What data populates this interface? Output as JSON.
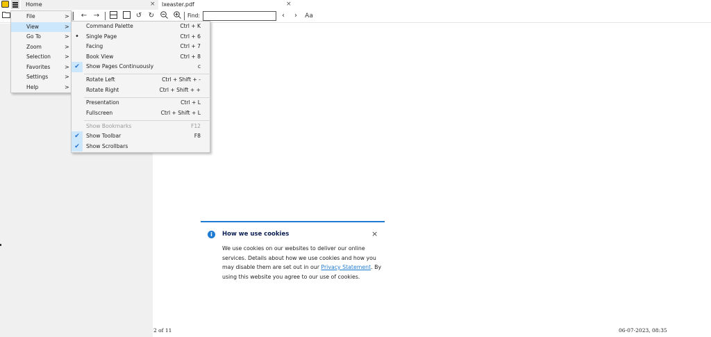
{
  "tabs": [
    {
      "label": "Home",
      "close_glyph": "×"
    },
    {
      "label": "lxeaster.pdf",
      "close_glyph": "×"
    }
  ],
  "toolbar": {
    "find_label": "Find:",
    "find_value": "",
    "icons": [
      "folder-icon",
      "arrow-left-icon",
      "arrow-right-icon",
      "fit-width-icon",
      "fit-page-icon",
      "rotate-left-icon",
      "rotate-right-icon",
      "zoom-out-icon",
      "zoom-in-icon",
      "find-prev-icon",
      "find-next-icon",
      "match-case-icon"
    ],
    "match_case_glyph": "Aa"
  },
  "main_menu": {
    "items": [
      {
        "label": "File",
        "arrow": ">"
      },
      {
        "label": "View",
        "arrow": ">",
        "active": true
      },
      {
        "label": "Go To",
        "arrow": ">"
      },
      {
        "label": "Zoom",
        "arrow": ">"
      },
      {
        "label": "Selection",
        "arrow": ">"
      },
      {
        "label": "Favorites",
        "arrow": ">"
      },
      {
        "label": "Settings",
        "arrow": ">"
      },
      {
        "label": "Help",
        "arrow": ">"
      }
    ]
  },
  "view_menu": {
    "items": [
      {
        "label": "Command Palette",
        "shortcut": "Ctrl + K"
      },
      {
        "label": "Single Page",
        "shortcut": "Ctrl + 6",
        "state": "bullet"
      },
      {
        "label": "Facing",
        "shortcut": "Ctrl + 7"
      },
      {
        "label": "Book View",
        "shortcut": "Ctrl + 8"
      },
      {
        "label": "Show Pages Continuously",
        "shortcut": "c",
        "state": "checked"
      },
      {
        "label": "Rotate Left",
        "shortcut": "Ctrl + Shift + -"
      },
      {
        "label": "Rotate Right",
        "shortcut": "Ctrl + Shift + +"
      },
      {
        "label": "Presentation",
        "shortcut": "Ctrl + L"
      },
      {
        "label": "Fullscreen",
        "shortcut": "Ctrl + Shift + L"
      },
      {
        "label": "Show Bookmarks",
        "shortcut": "F12",
        "state": "disabled"
      },
      {
        "label": "Show Toolbar",
        "shortcut": "F8",
        "state": "checked"
      },
      {
        "label": "Show Scrollbars",
        "shortcut": "",
        "state": "checked"
      }
    ]
  },
  "document": {
    "page_count": "2 of 11",
    "date": "06-07-2023, 08:35"
  },
  "cookie_banner": {
    "title": "How we use cookies",
    "info_glyph": "i",
    "close_glyph": "×",
    "body_before_link": "We use cookies on our websites to deliver our online services. Details about how we use cookies and how you may disable them are set out in our ",
    "link_text": "Privacy Statement",
    "body_after_link": ". By using this website you agree to our use of cookies."
  },
  "colors": {
    "accent": "#1f7bd1",
    "menu_highlight": "#cce6fb",
    "sidebar_bg": "#f0f0f0"
  }
}
